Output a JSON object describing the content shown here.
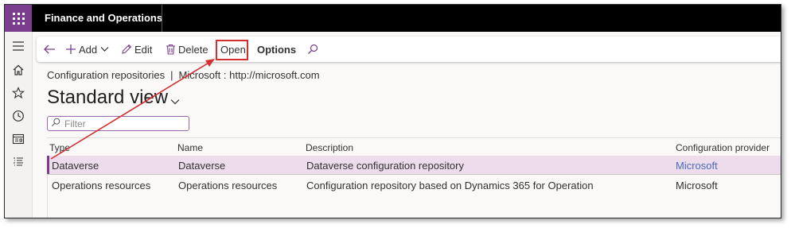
{
  "app": {
    "title": "Finance and Operations"
  },
  "nav": {
    "items": [
      "menu-icon",
      "home-icon",
      "favorites-icon",
      "recent-icon",
      "workspaces-icon",
      "modules-icon"
    ]
  },
  "toolbar": {
    "add_label": "Add",
    "edit_label": "Edit",
    "delete_label": "Delete",
    "open_label": "Open",
    "options_label": "Options"
  },
  "breadcrumb": {
    "page": "Configuration repositories",
    "separator": "|",
    "context": "Microsoft : http://microsoft.com"
  },
  "view": {
    "title": "Standard view"
  },
  "filter": {
    "placeholder": "Filter",
    "value": ""
  },
  "grid": {
    "columns": [
      "Type",
      "Name",
      "Description",
      "Configuration provider"
    ],
    "rows": [
      {
        "type": "Dataverse",
        "name": "Dataverse",
        "description": "Dataverse configuration repository",
        "provider": "Microsoft",
        "selected": true
      },
      {
        "type": "Operations resources",
        "name": "Operations resources",
        "description": "Configuration repository based on Dynamics 365 for Operation",
        "provider": "Microsoft",
        "selected": false
      }
    ]
  },
  "colors": {
    "brand": "#7b3d8e",
    "annotation": "#d32f2f",
    "selected_row": "#ecdcec",
    "link": "#4b6cb7"
  }
}
